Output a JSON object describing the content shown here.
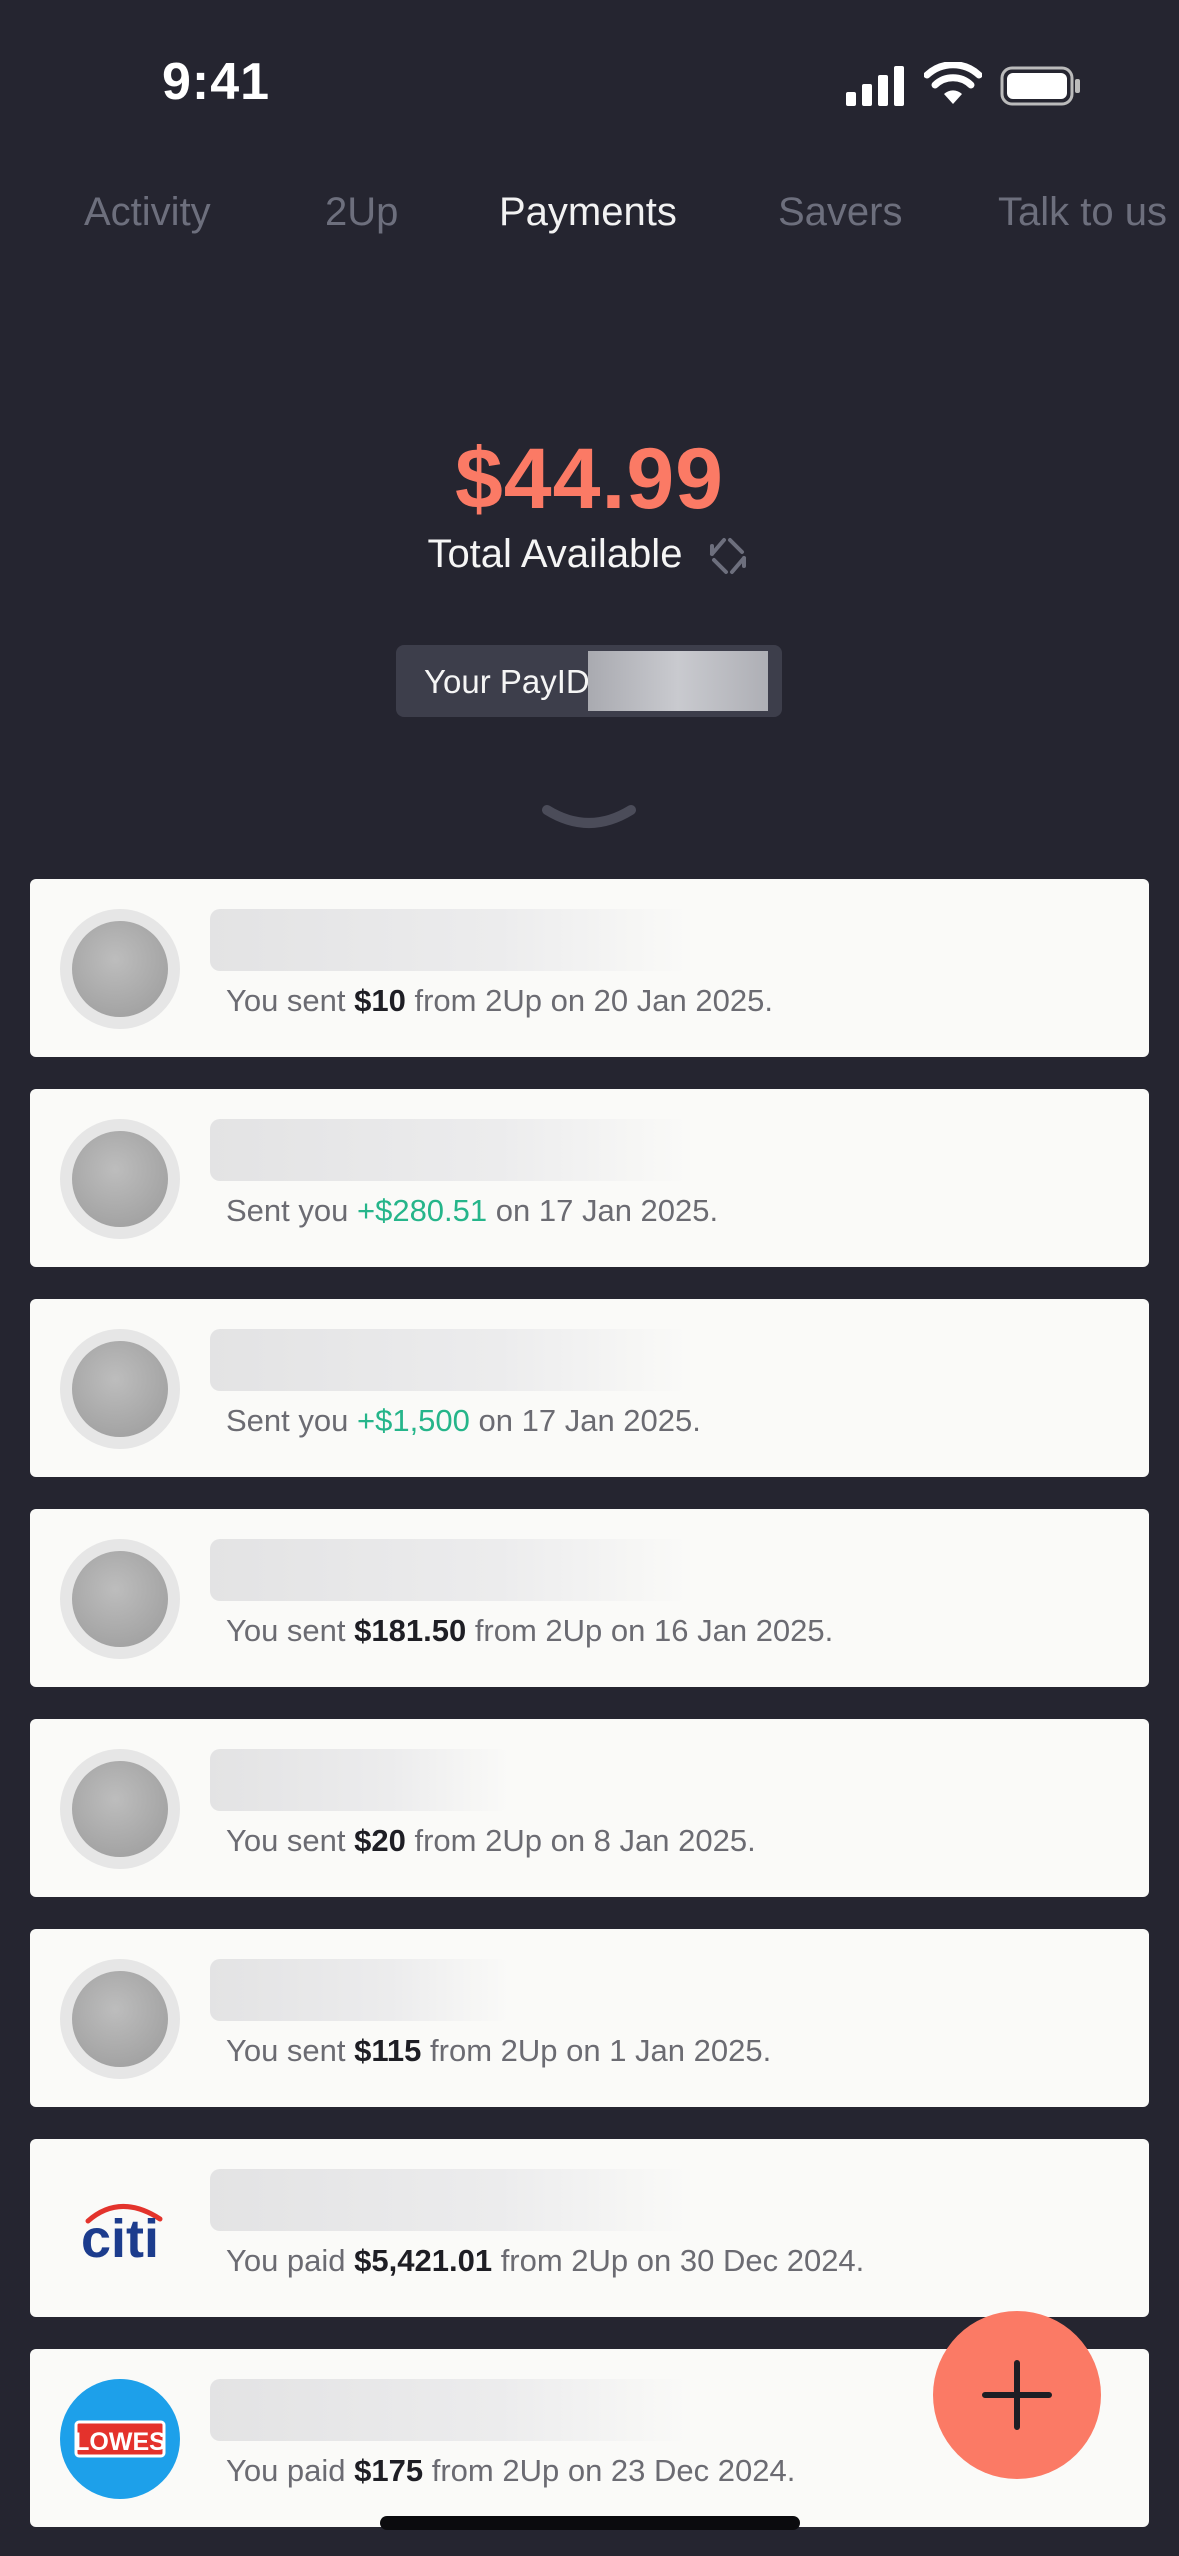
{
  "status": {
    "time": "9:41"
  },
  "tabs": [
    {
      "label": "Activity",
      "active": false
    },
    {
      "label": "2Up",
      "active": false
    },
    {
      "label": "Payments",
      "active": true
    },
    {
      "label": "Savers",
      "active": false
    },
    {
      "label": "Talk to us",
      "active": false
    }
  ],
  "balance": {
    "amount": "$44.99",
    "label": "Total Available"
  },
  "payid": {
    "label": "Your PayID:"
  },
  "colors": {
    "accent": "#fb7a65",
    "positive": "#25b58a",
    "background": "#252530",
    "card": "#fafaf8"
  },
  "payments": [
    {
      "avatar": "generic",
      "pre": "You sent ",
      "amount": "$10",
      "post": " from 2Up on 20 Jan 2025.",
      "positive": false
    },
    {
      "avatar": "generic",
      "pre": "Sent you ",
      "amount": "+$280.51",
      "post": " on 17 Jan 2025.",
      "positive": true
    },
    {
      "avatar": "generic",
      "pre": "Sent you ",
      "amount": "+$1,500",
      "post": " on 17 Jan 2025.",
      "positive": true
    },
    {
      "avatar": "generic",
      "pre": "You sent ",
      "amount": "$181.50",
      "post": " from 2Up on 16 Jan 2025.",
      "positive": false
    },
    {
      "avatar": "generic",
      "pre": "You sent ",
      "amount": "$20",
      "post": " from 2Up on 8 Jan 2025.",
      "positive": false
    },
    {
      "avatar": "generic",
      "pre": "You sent ",
      "amount": "$115",
      "post": " from 2Up on 1 Jan 2025.",
      "positive": false
    },
    {
      "avatar": "citi",
      "logo_text": "citi",
      "pre": "You paid ",
      "amount": "$5,421.01",
      "post": " from 2Up on 30 Dec 2024.",
      "positive": false
    },
    {
      "avatar": "lowes",
      "logo_text": "LOWES",
      "pre": "You paid ",
      "amount": "$175",
      "post": " from 2Up on 23 Dec 2024.",
      "positive": false
    }
  ],
  "icons": {
    "fab": "plus-icon",
    "sync": "sync-arrows-icon",
    "expand": "chevron-down-icon"
  }
}
